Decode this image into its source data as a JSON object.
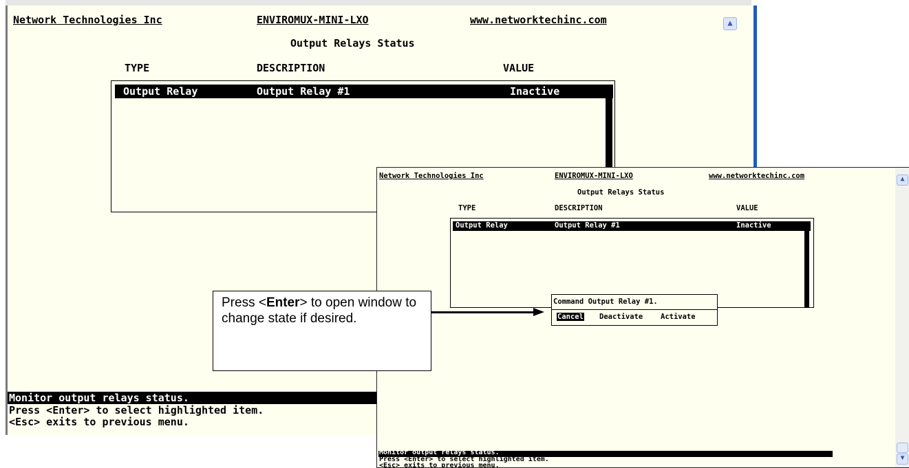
{
  "header": {
    "company": "Network Technologies Inc",
    "product": "ENVIROMUX-MINI-LXO",
    "url": "www.networktechinc.com"
  },
  "screen_title": "Output Relays Status",
  "columns": {
    "type": "TYPE",
    "description": "DESCRIPTION",
    "value": "VALUE"
  },
  "rows": [
    {
      "type": "Output Relay",
      "description": "Output Relay #1",
      "value": "Inactive"
    }
  ],
  "footer": {
    "line1": "Monitor output relays status.",
    "line2": "Press <Enter> to select highlighted item.",
    "line3": "<Esc> exits to previous menu."
  },
  "popup": {
    "title": "Command Output Relay #1.",
    "options": [
      "Cancel",
      "Deactivate",
      "Activate"
    ],
    "selected": "Cancel"
  },
  "callout": {
    "pre": "Press <",
    "key": "Enter",
    "post": "> to open window to change state if desired."
  },
  "icons": {
    "scroll_up": "chevron-up-icon",
    "scroll_down": "chevron-down-icon"
  }
}
